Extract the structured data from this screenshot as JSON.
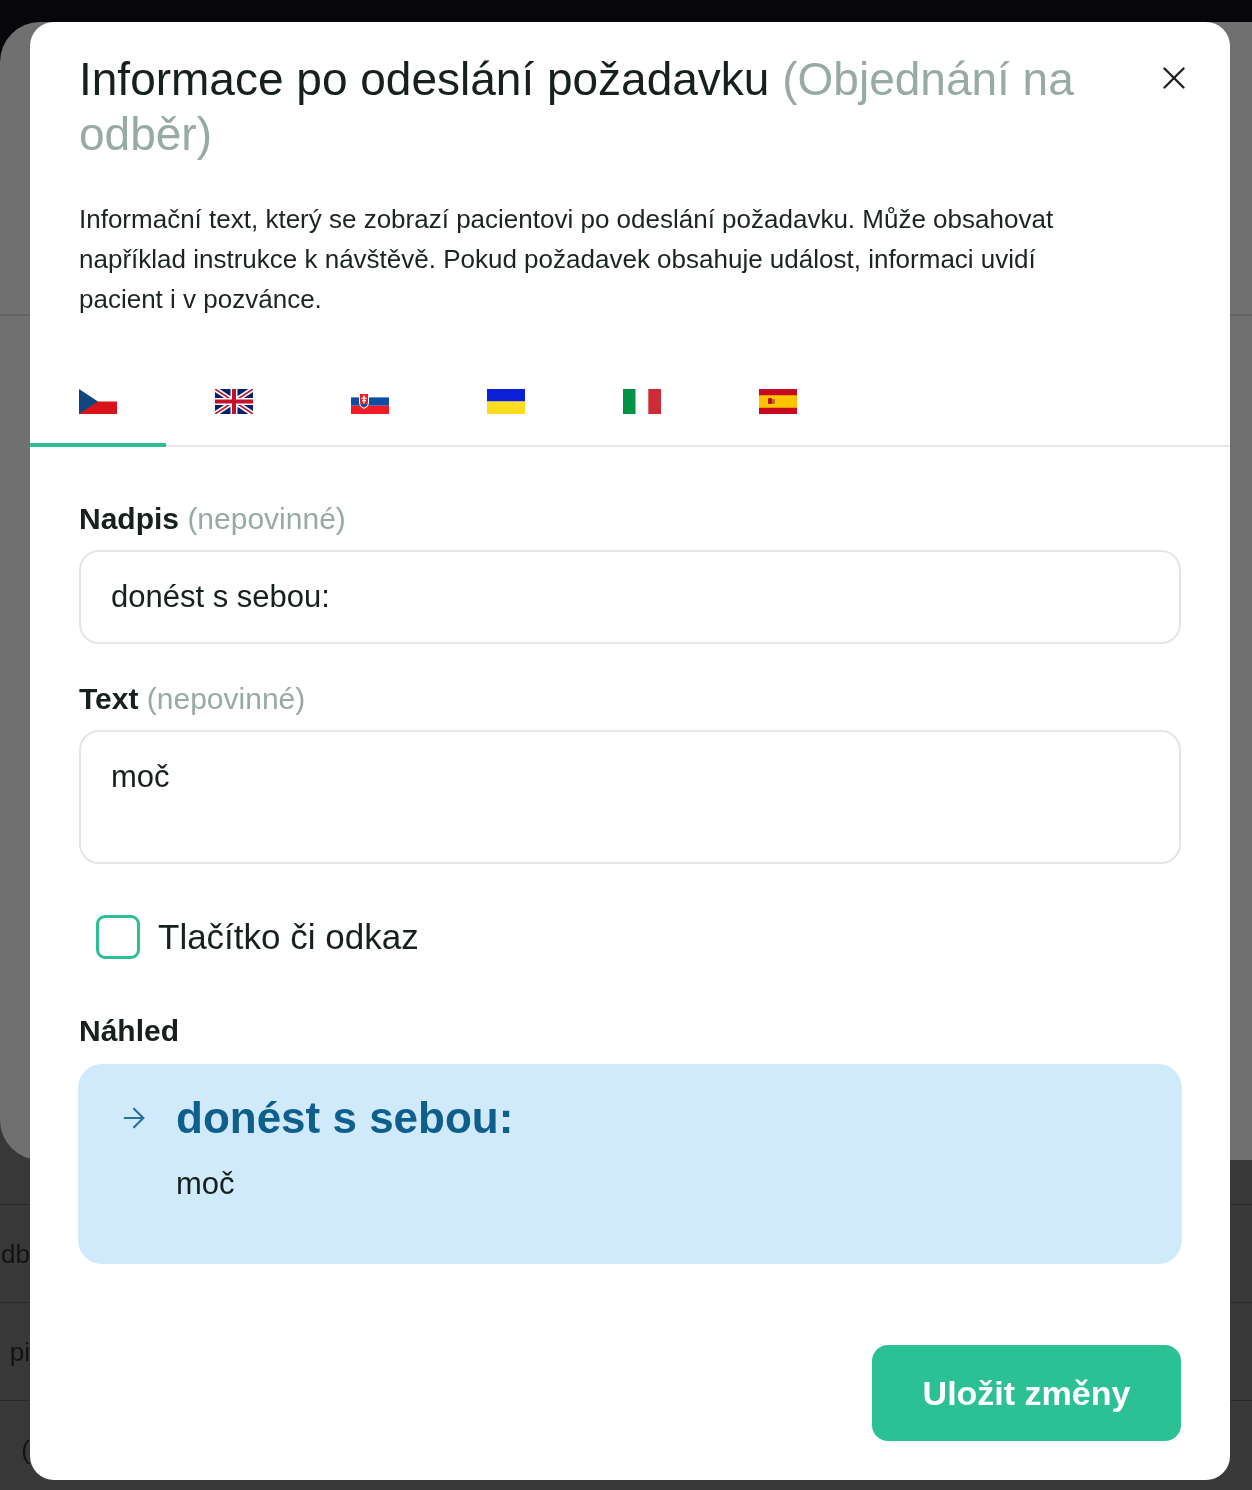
{
  "background": {
    "rows": [
      "db",
      "pi",
      "("
    ]
  },
  "dialog": {
    "title": "Informace po odeslání požadavku",
    "title_suffix": "(Objednání na odběr)",
    "description": "Informační text, který se zobrazí pacientovi po odeslání požadavku. Může obsahovat například instrukce k návštěvě. Pokud požadavek obsahuje událost, informaci uvidí pacient i v pozvánce."
  },
  "language_tabs": [
    {
      "kind": "czech",
      "selected": true
    },
    {
      "kind": "british",
      "selected": false
    },
    {
      "kind": "slovak",
      "selected": false
    },
    {
      "kind": "ukrainian",
      "selected": false
    },
    {
      "kind": "italian",
      "selected": false
    },
    {
      "kind": "spanish",
      "selected": false
    }
  ],
  "fields": [
    {
      "kind": "input",
      "label": "Nadpis",
      "hint": "(nepovinné)",
      "value": "donést s sebou:"
    },
    {
      "kind": "textarea",
      "label": "Text",
      "hint": "(nepovinné)",
      "value": "moč"
    }
  ],
  "checkbox": {
    "label": "Tlačítko či odkaz",
    "checked": false
  },
  "preview": {
    "label": "Náhled",
    "heading": "donést s sebou:",
    "text": "moč"
  },
  "save_button": "Uložit změny"
}
